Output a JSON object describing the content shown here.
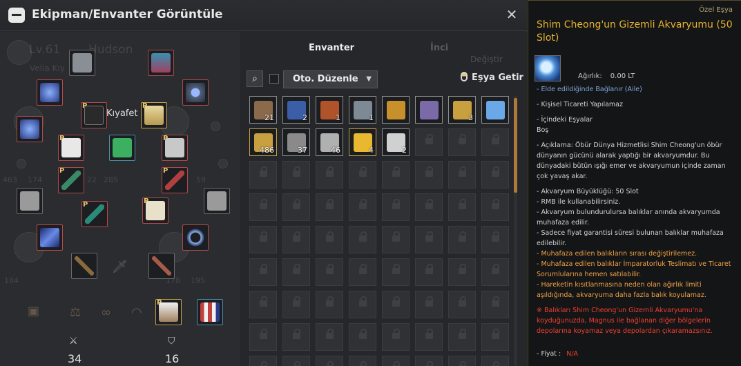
{
  "window": {
    "title": "Ekipman/Envanter Görüntüle",
    "close_icon": "close-icon"
  },
  "equipment": {
    "ghost_level": "Lv.61",
    "ghost_name": "Hudson",
    "ghost_family": "Velia Kıy",
    "ghost_change": "Değiştir",
    "slot_label": "Kıyafet",
    "ghost_numbers": [
      "463",
      "174",
      "22",
      "285",
      "59",
      "184",
      "178",
      "195"
    ],
    "stat_attack_value": "34",
    "stat_defense_value": "16",
    "attack_icon": "sword-icon",
    "defense_icon": "shield-icon",
    "pearl_marker": "P"
  },
  "inventory": {
    "tab_inventory": "Envanter",
    "tab_pearl": "İnci",
    "sort_label": "Oto. Düzenle",
    "fetch_label": "Eşya Getir",
    "items": [
      {
        "count": "21",
        "color": "#8a6a4a"
      },
      {
        "count": "2",
        "color": "#3a5fa8"
      },
      {
        "count": "1",
        "color": "#b0522a"
      },
      {
        "count": "1",
        "color": "#7d8a96"
      },
      {
        "count": "",
        "color": "#c8902a"
      },
      {
        "count": "",
        "color": "#7a6aa8"
      },
      {
        "count": "3",
        "color": "#c8a040"
      },
      {
        "count": "",
        "color": "#6aa8e8"
      },
      {
        "count": "486",
        "color": "#c8a040"
      },
      {
        "count": "37",
        "color": "#8a8a8a"
      },
      {
        "count": "46",
        "color": "#b0b0b0"
      },
      {
        "count": "4",
        "color": "#e8b830"
      },
      {
        "count": "2",
        "color": "#d0d0d0"
      }
    ]
  },
  "tooltip": {
    "category": "Özel Eşya",
    "name": "Shim Cheong'un Gizemli Akvaryumu (50 Slot)",
    "weight_label": "Ağırlık:",
    "weight_value": "0.00 LT",
    "bind": "- Elde edildiğinde Bağlanır (Aile)",
    "trade": "- Kişisel Ticareti Yapılamaz",
    "contents_label": "- İçindeki Eşyalar",
    "contents_value": "Boş",
    "description": "- Açıklama: Öbür Dünya Hizmetlisi Shim Cheong'un öbür dünyanın gücünü alarak yaptığı bir akvaryumdur. Bu dünyadaki bütün ışığı emer ve akvaryumun içinde zaman çok yavaş akar.",
    "size": "- Akvaryum Büyüklüğü: 50 Slot",
    "rmb": "- RMB ile kullanabilirsiniz.",
    "preserve": "- Akvaryum bulundurulursa balıklar anında akvaryumda muhafaza edilir.",
    "guarantee": "- Sadece fiyat garantisi süresi bulunan balıklar muhafaza edilebilir.",
    "order": "- Muhafaza edilen balıkların sırası değiştirilemez.",
    "imperial": "- Muhafaza edilen balıklar İmparatorluk Teslimatı ve Ticaret Sorumlularına hemen satılabilir.",
    "weight_limit": "- Hareketin kısıtlanmasına neden olan ağırlık limiti aşıldığında, akvaryuma daha fazla balık koyulamaz.",
    "warning": "※ Balıkları Shim Cheong'un Gizemli Akvaryumu'na koyduğunuzda, Magnus ile bağlanan diğer bölgelerin depolarına koyamaz veya depolardan çıkaramazsınız.",
    "price_label": "- Fiyat :",
    "price_value": "N/A"
  }
}
